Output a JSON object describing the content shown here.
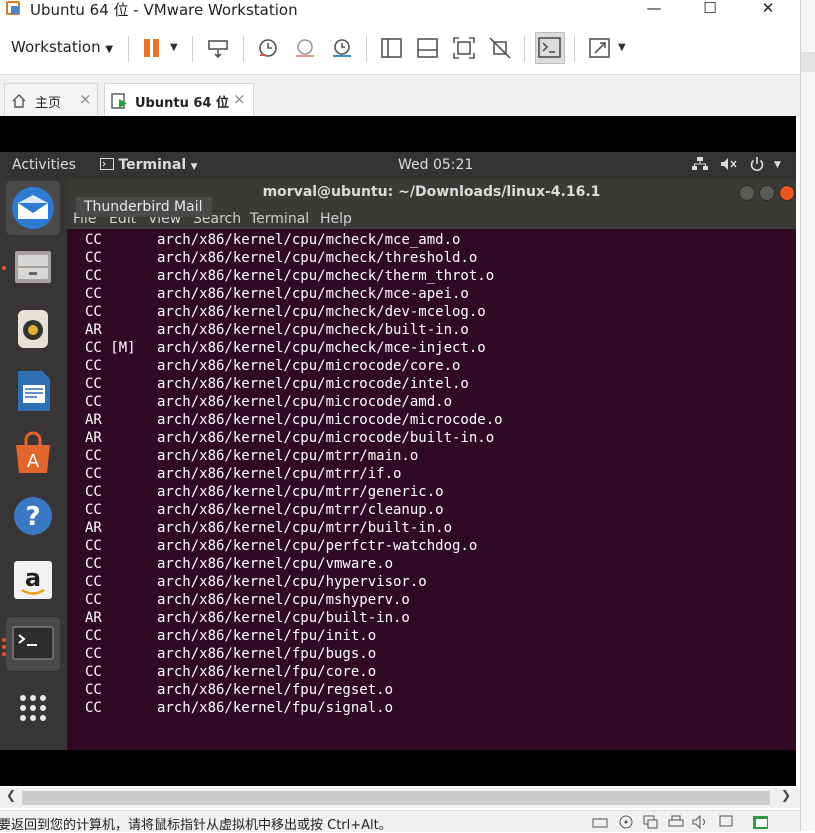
{
  "window": {
    "title": "Ubuntu 64 位 - VMware Workstation",
    "minimize": "—",
    "maximize": "☐",
    "close": "✕"
  },
  "toolbar": {
    "workstation_label": "Workstation",
    "menu_caret": "▼"
  },
  "tabs": [
    {
      "label": "主页",
      "close": "×"
    },
    {
      "label": "Ubuntu 64 位",
      "close": "×"
    }
  ],
  "gnome": {
    "activities": "Activities",
    "app_menu": "Terminal",
    "clock": "Wed 05:21"
  },
  "dock": {
    "tooltip": "Thunderbird Mail",
    "items": [
      "thunderbird-icon",
      "files-icon",
      "rhythmbox-icon",
      "writer-icon",
      "software-icon",
      "help-icon",
      "amazon-icon",
      "terminal-icon",
      "show-apps-icon"
    ]
  },
  "terminal": {
    "title": "morval@ubuntu: ~/Downloads/linux-4.16.1",
    "menu": [
      "File",
      "Edit",
      "View",
      "Search",
      "Terminal",
      "Help"
    ],
    "lines": [
      {
        "tag": "CC",
        "path": "arch/x86/kernel/cpu/mcheck/mce_amd.o"
      },
      {
        "tag": "CC",
        "path": "arch/x86/kernel/cpu/mcheck/threshold.o"
      },
      {
        "tag": "CC",
        "path": "arch/x86/kernel/cpu/mcheck/therm_throt.o"
      },
      {
        "tag": "CC",
        "path": "arch/x86/kernel/cpu/mcheck/mce-apei.o"
      },
      {
        "tag": "CC",
        "path": "arch/x86/kernel/cpu/mcheck/dev-mcelog.o"
      },
      {
        "tag": "AR",
        "path": "arch/x86/kernel/cpu/mcheck/built-in.o"
      },
      {
        "tag": "CC [M]",
        "path": "arch/x86/kernel/cpu/mcheck/mce-inject.o"
      },
      {
        "tag": "CC",
        "path": "arch/x86/kernel/cpu/microcode/core.o"
      },
      {
        "tag": "CC",
        "path": "arch/x86/kernel/cpu/microcode/intel.o"
      },
      {
        "tag": "CC",
        "path": "arch/x86/kernel/cpu/microcode/amd.o"
      },
      {
        "tag": "AR",
        "path": "arch/x86/kernel/cpu/microcode/microcode.o"
      },
      {
        "tag": "AR",
        "path": "arch/x86/kernel/cpu/microcode/built-in.o"
      },
      {
        "tag": "CC",
        "path": "arch/x86/kernel/cpu/mtrr/main.o"
      },
      {
        "tag": "CC",
        "path": "arch/x86/kernel/cpu/mtrr/if.o"
      },
      {
        "tag": "CC",
        "path": "arch/x86/kernel/cpu/mtrr/generic.o"
      },
      {
        "tag": "CC",
        "path": "arch/x86/kernel/cpu/mtrr/cleanup.o"
      },
      {
        "tag": "AR",
        "path": "arch/x86/kernel/cpu/mtrr/built-in.o"
      },
      {
        "tag": "CC",
        "path": "arch/x86/kernel/cpu/perfctr-watchdog.o"
      },
      {
        "tag": "CC",
        "path": "arch/x86/kernel/cpu/vmware.o"
      },
      {
        "tag": "CC",
        "path": "arch/x86/kernel/cpu/hypervisor.o"
      },
      {
        "tag": "CC",
        "path": "arch/x86/kernel/cpu/mshyperv.o"
      },
      {
        "tag": "AR",
        "path": "arch/x86/kernel/cpu/built-in.o"
      },
      {
        "tag": "CC",
        "path": "arch/x86/kernel/fpu/init.o"
      },
      {
        "tag": "CC",
        "path": "arch/x86/kernel/fpu/bugs.o"
      },
      {
        "tag": "CC",
        "path": "arch/x86/kernel/fpu/core.o"
      },
      {
        "tag": "CC",
        "path": "arch/x86/kernel/fpu/regset.o"
      },
      {
        "tag": "CC",
        "path": "arch/x86/kernel/fpu/signal.o"
      }
    ]
  },
  "status": {
    "message": "要返回到您的计算机，请将鼠标指针从虚拟机中移出或按 Ctrl+Alt。"
  },
  "colors": {
    "terminal_bg": "#300a24",
    "ubuntu_orange": "#e95420",
    "pause_orange": "#e9742a"
  }
}
